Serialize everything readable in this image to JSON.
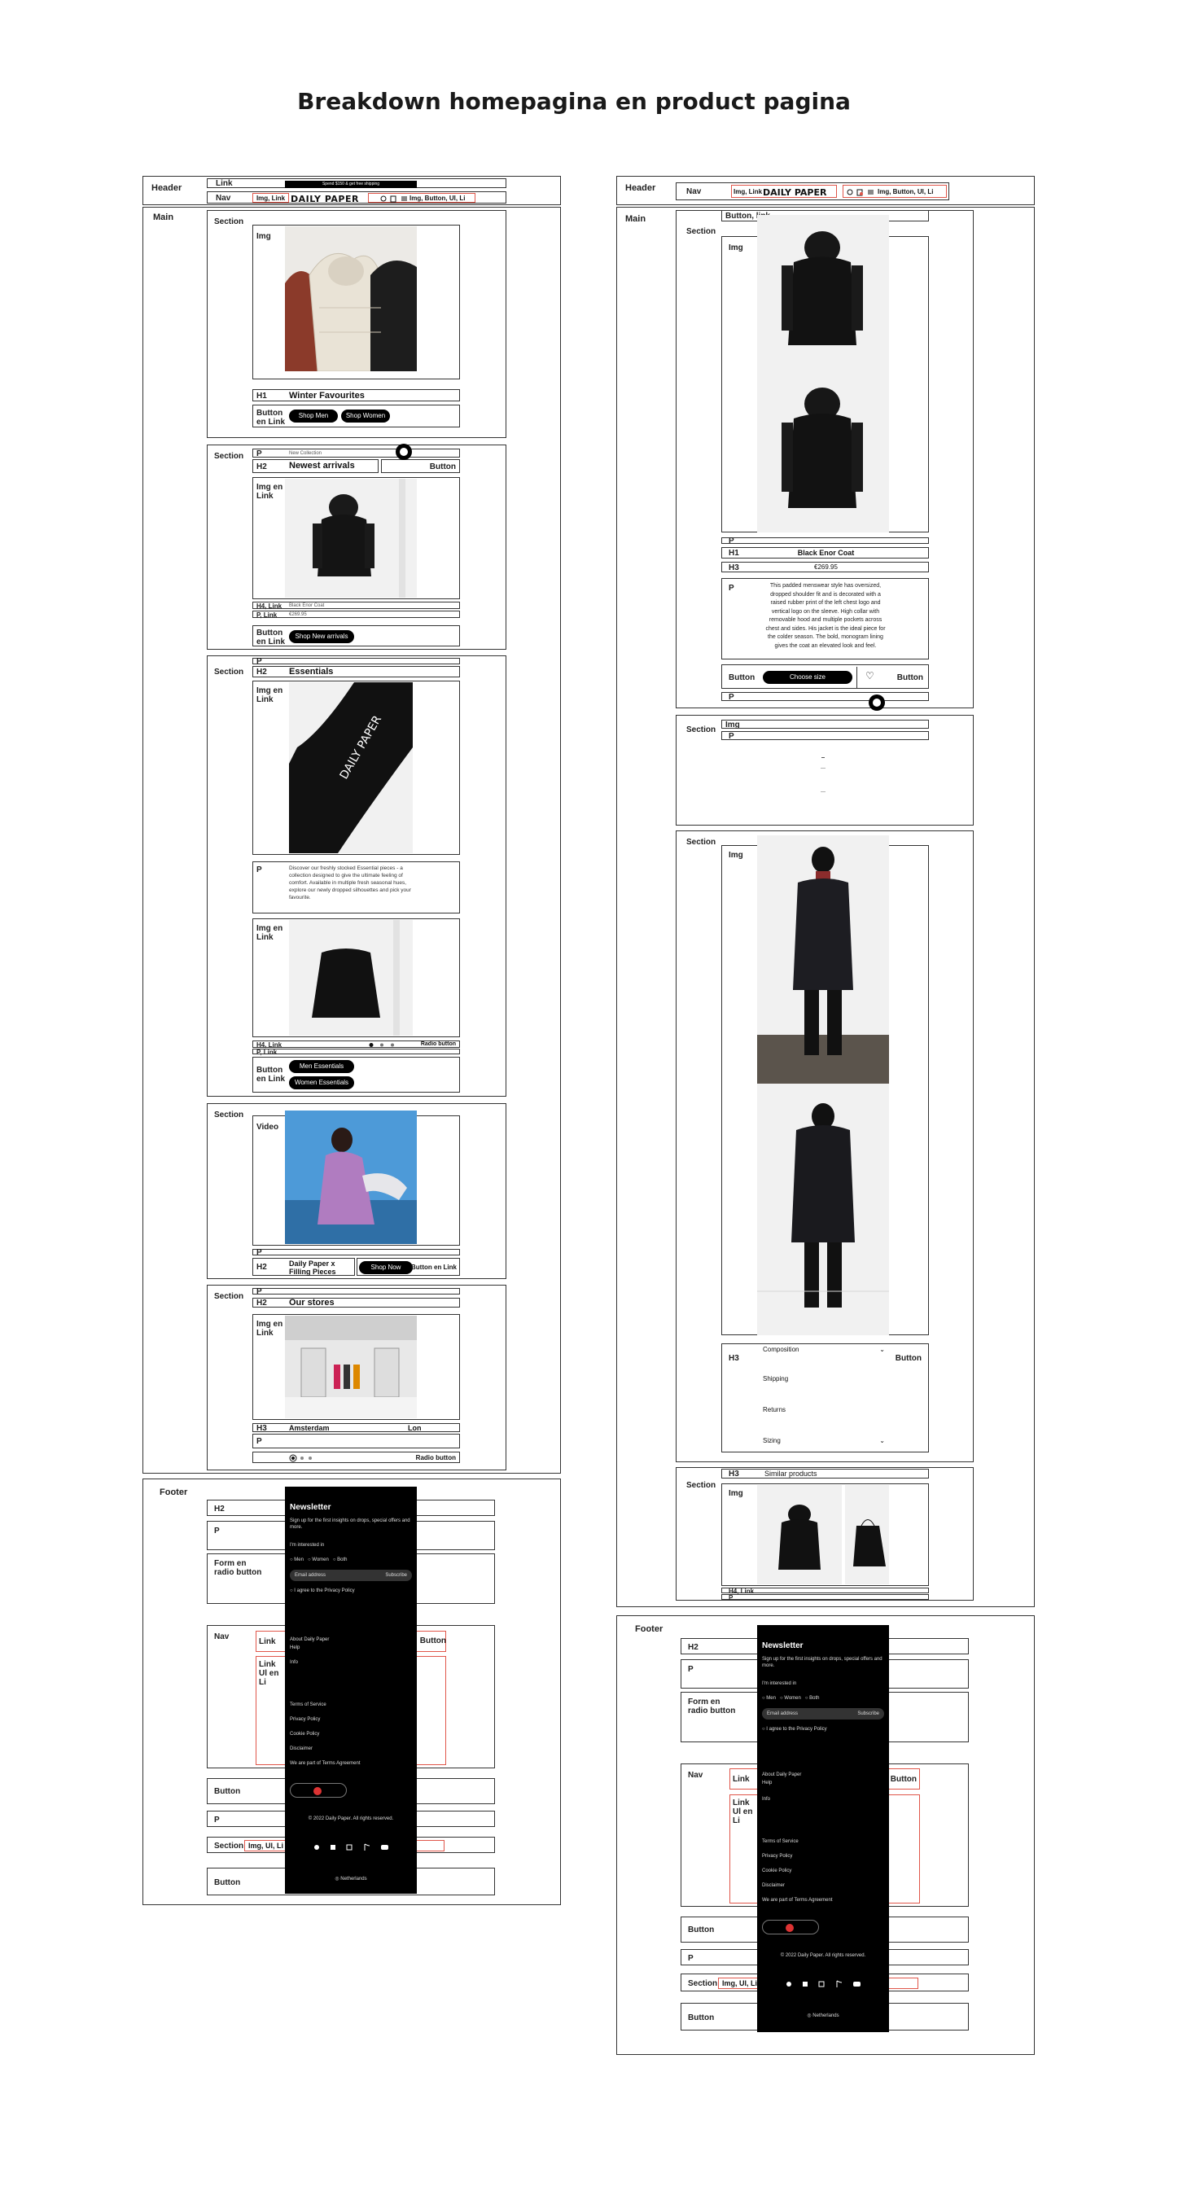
{
  "title": "Breakdown homepagina en product pagina",
  "labels": {
    "header": "Header",
    "nav": "Nav",
    "link": "Link",
    "main": "Main",
    "section": "Section",
    "img": "Img",
    "img_en_link": "Img en Link",
    "h1": "H1",
    "h2": "H2",
    "h3": "H3",
    "h4_link": "H4, Link",
    "p": "P",
    "p_link": "P, Link",
    "button": "Button",
    "button_link": "Button, link",
    "button_en_link": "Button en Link",
    "video": "Video",
    "radio_button": "Radio button",
    "footer": "Footer",
    "form_radio": "Form en radio button",
    "link_ul_li": "Link Ul en Li",
    "img_link_annot": "Img, Link",
    "img_button_ul_li": "Img, Button, Ul, Li",
    "img_ul_li": "Img, Ul, Li"
  },
  "site": {
    "logo": "DAILY PAPER",
    "promo": "Spend $150 & get free shipping",
    "winter": "Winter Favourites",
    "shop_men": "Shop Men",
    "shop_women": "Shop Women",
    "new_collection": "New Collection",
    "newest": "Newest arrivals",
    "shop_new": "Shop New arrivals",
    "essentials": "Essentials",
    "essentials_p": "Discover our freshly stocked Essential pieces - a collection designed to give the ultimate feeling of comfort. Available in multiple fresh seasonal hues, explore our newly dropped silhouettes and pick your favourite.",
    "men_essentials": "Men Essentials",
    "women_essentials": "Women Essentials",
    "filling": "Daily Paper x Filling Pieces",
    "shop_now": "Shop Now",
    "our_stores": "Our stores",
    "amsterdam": "Amsterdam",
    "london": "Lon",
    "product_name": "Black Enor Coat",
    "product_price": "€269.95",
    "product_desc": "This padded menswear style has oversized, dropped shoulder fit and is decorated with a raised rubber print of the left chest logo and vertical logo on the sleeve. High collar with removable hood and multiple pockets across chest and sides. His jacket is the ideal piece for the colder season. The bold, monogram lining gives the coat an elevated look and feel.",
    "choose_size": "Choose size",
    "composition": "Composition",
    "shipping": "Shipping",
    "returns": "Returns",
    "sizing": "Sizing",
    "similar": "Similar products",
    "newsletter": "Newsletter",
    "newsletter_p": "Sign up for the first insights on drops, special offers and more.",
    "im_interested": "I'm interested in",
    "men": "Men",
    "women": "Women",
    "both": "Both",
    "email": "Email address",
    "subscribe": "Subscribe",
    "privacy": "I agree to the Privacy Policy",
    "about": "About Daily Paper",
    "help": "Help",
    "info": "Info",
    "terms": "Terms of Service",
    "privacy_policy": "Privacy Policy",
    "cookie_policy": "Cookie Policy",
    "disclaimer": "Disclaimer",
    "terms_agreement": "We are part of Terms Agreement",
    "copyright": "© 2022 Daily Paper. All rights reserved.",
    "netherlands": "Netherlands"
  },
  "colors": {
    "annotation_red": "#e0564a",
    "outline": "#333333",
    "black": "#000000",
    "screenshot_bg": "#f1f1f1"
  },
  "icons": [
    "search-icon",
    "bag-icon",
    "menu-icon",
    "twitter-icon",
    "facebook-icon",
    "instagram-icon",
    "tiktok-icon",
    "youtube-icon",
    "flag-icon",
    "chevron-icon"
  ]
}
